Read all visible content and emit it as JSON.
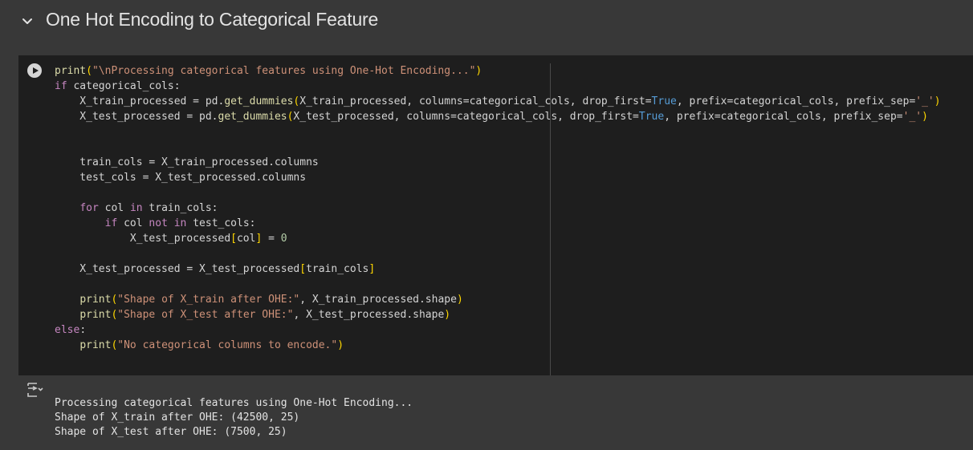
{
  "section": {
    "title": "One Hot Encoding to Categorical Feature"
  },
  "code_lines": [
    "print(\"\\nProcessing categorical features using One-Hot Encoding...\")",
    "if categorical_cols:",
    "    X_train_processed = pd.get_dummies(X_train_processed, columns=categorical_cols, drop_first=True, prefix=categorical_cols, prefix_sep='_')",
    "    X_test_processed = pd.get_dummies(X_test_processed, columns=categorical_cols, drop_first=True, prefix=categorical_cols, prefix_sep='_')",
    "",
    "",
    "    train_cols = X_train_processed.columns",
    "    test_cols = X_test_processed.columns",
    "",
    "    for col in train_cols:",
    "        if col not in test_cols:",
    "            X_test_processed[col] = 0",
    "",
    "    X_test_processed = X_test_processed[train_cols]",
    "",
    "    print(\"Shape of X_train after OHE:\", X_train_processed.shape)",
    "    print(\"Shape of X_test after OHE:\", X_test_processed.shape)",
    "else:",
    "    print(\"No categorical columns to encode.\")"
  ],
  "output_lines": [
    "Processing categorical features using One-Hot Encoding...",
    "Shape of X_train after OHE: (42500, 25)",
    "Shape of X_test after OHE: (7500, 25)"
  ],
  "icons": {
    "collapse": "chevron-down-icon",
    "run": "play-icon",
    "output_toggle": "output-collapse-icon"
  },
  "colors": {
    "background": "#383838",
    "cell_background": "#1e1e1e",
    "keyword": "#c586c0",
    "function": "#dcdcaa",
    "string": "#ce9178",
    "builtin": "#569cd6",
    "bracket": "#ffd700"
  }
}
